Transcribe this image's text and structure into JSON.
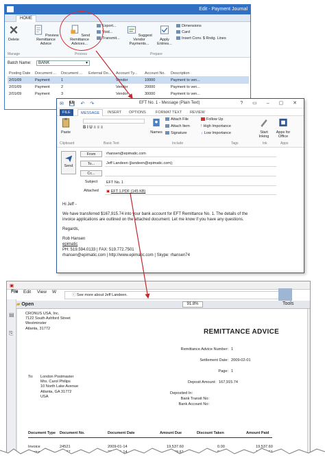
{
  "colors": {
    "nav_blue": "#2f6fc4",
    "outlook_blue": "#2b579a",
    "arrow_red": "#c0282d"
  },
  "journal": {
    "title": "Edit - Payment Journal",
    "tab_home": "HOME",
    "buttons": {
      "delete": "Delete",
      "preview_remittance": "Preview Remittance Advice",
      "send_remittance": "Send Remittance Advices...",
      "export": "Export...",
      "void": "Void...",
      "transmit": "Transmit...",
      "suggest_vendor": "Suggest Vendor Payments...",
      "apply_entries": "Apply Entries...",
      "dimensions": "Dimensions",
      "card": "Card",
      "insert_conv": "Insert Conv. $ Rndg. Lines"
    },
    "groups": {
      "manage": "Manage",
      "process": "Process",
      "prepare": "Prepare"
    },
    "batch_label": "Batch Name:",
    "batch_value": "BANK",
    "columns": [
      "Posting Date",
      "Document ...",
      "Document ...",
      "External Do...",
      "Account Ty...",
      "Account No.",
      "Description"
    ],
    "rows": [
      [
        "2/01/09",
        "Payment",
        "1",
        "",
        "Vendor",
        "10000",
        "Payment to ven..."
      ],
      [
        "2/01/09",
        "Payment",
        "2",
        "",
        "Vendor",
        "20000",
        "Payment to ven..."
      ],
      [
        "2/01/09",
        "Payment",
        "3",
        "",
        "Vendor",
        "30000",
        "Payment to ven..."
      ]
    ]
  },
  "email": {
    "title": "EFT No. 1 - Message (Plain Text)",
    "tabs": [
      "FILE",
      "MESSAGE",
      "INSERT",
      "OPTIONS",
      "FORMAT TEXT",
      "REVIEW"
    ],
    "ribbon": {
      "paste": "Paste",
      "clipboard": "Clipboard",
      "basic_text": "Basic Text",
      "names": "Names",
      "attach_file": "Attach File",
      "attach_item": "Attach Item",
      "signature": "Signature",
      "include": "Include",
      "follow_up": "Follow Up",
      "high_importance": "High Importance",
      "low_importance": "Low Importance",
      "tags": "Tags",
      "start_inking": "Start Inking",
      "ink": "Ink",
      "apps_for_office": "Apps for Office",
      "apps": "Apps"
    },
    "from_label": "From",
    "from_value": "rhansen@epimatic.com",
    "send": "Send",
    "to_label": "To...",
    "to_value": "Jeff Landeen (jlandeen@epimatic.com);",
    "cc_label": "Cc...",
    "subject_label": "Subject",
    "subject_value": "EFT No. 1",
    "attached_label": "Attached",
    "attached_value": "EFT 1.PDF (145 KB)",
    "body": {
      "greeting": "Hi Jeff -",
      "para1": "We have transferred $167,915.74 into your bank account for EFT Remittance No. 1.  The details of the invoice applications are outlined on the attached document.  Let me know if you have any questions.",
      "closing": "Regards,",
      "sig_name": "Rob Hansen",
      "sig_company": "epimatic",
      "sig_phone": "PH: 519.594.0133 | FAX: 519.772.7501",
      "sig_contact": "rhansen@epimatic.com | http://www.epimatic.com | Skype: rhansen74"
    }
  },
  "pdf": {
    "menu": [
      "File",
      "Edit",
      "View",
      "W"
    ],
    "open": "Open",
    "zoom": "91.8%",
    "tools": "Tools",
    "tip": "See more about Jeff Landeen.",
    "company": [
      "CRONUS USA, Inc.",
      "7122 South Ashford Street",
      "Westminster",
      "Atlanta, 31772"
    ],
    "doc_title": "REMITTANCE ADVICE",
    "fields": [
      {
        "label": "Remittance Advice Number:",
        "value": "1"
      },
      {
        "label": "Settlement Date:",
        "value": "2009-02-01"
      },
      {
        "label": "Page:",
        "value": "1"
      },
      {
        "label": "Deposit Amount:",
        "value": "167,915.74"
      },
      {
        "label": "Deposited In:",
        "value": ""
      },
      {
        "label": "Bank Transit No:",
        "value": ""
      },
      {
        "label": "Bank Account No:",
        "value": ""
      }
    ],
    "to_label": "To:",
    "to_address": [
      "London Postmaster",
      "Mrs. Carol Philips",
      "10 North Lake Avenue",
      "Atlanta, GA  31772",
      "USA"
    ],
    "table_headers": [
      "Document Type",
      "Document No.",
      "Document Date",
      "Amount Due",
      "Discount Taken",
      "Amount Paid"
    ],
    "table_rows": [
      [
        "Invoice",
        "24521",
        "2009-01-14",
        "19,537.60",
        "0.00",
        "19,537.60"
      ],
      [
        "Invoice",
        "23587",
        "2009-01-14",
        "10,149.61",
        "0.00",
        "10,149.61"
      ]
    ]
  }
}
